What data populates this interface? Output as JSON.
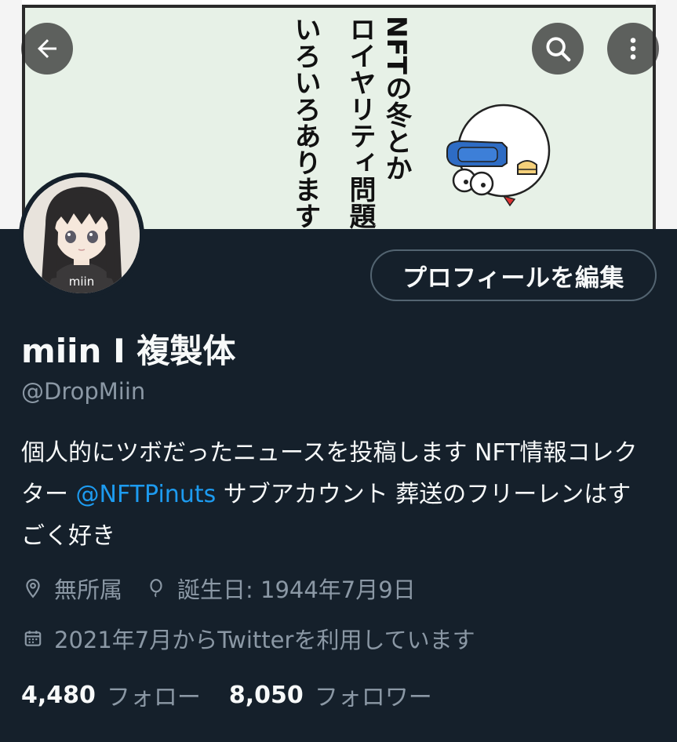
{
  "banner": {
    "manga_lines": [
      "NFTの冬とか",
      "ロイヤリティ問題とか",
      "いろいろありますなぁ"
    ]
  },
  "avatar": {
    "shirt_text": "miin"
  },
  "actions": {
    "edit_profile": "プロフィールを編集"
  },
  "profile": {
    "display_name": "miin I 複製体",
    "handle": "@DropMiin",
    "bio_part1": "個人的にツボだったニュースを投稿します NFT情報コレクター ",
    "bio_mention": "@NFTPinuts",
    "bio_part2": " サブアカウント 葬送のフリーレンはすごく好き",
    "location": "無所属",
    "birthday": "誕生日: 1944年7月9日",
    "joined": "2021年7月からTwitterを利用しています"
  },
  "stats": {
    "following_count": "4,480",
    "following_label": "フォロー",
    "followers_count": "8,050",
    "followers_label": "フォロワー"
  },
  "colors": {
    "background": "#15202b",
    "text_primary": "#f7f9f9",
    "text_secondary": "#8b98a5",
    "link": "#1d9bf0",
    "border": "#536471"
  },
  "icons": [
    "back-arrow-icon",
    "search-icon",
    "more-vertical-icon",
    "location-pin-icon",
    "balloon-icon",
    "calendar-icon"
  ]
}
